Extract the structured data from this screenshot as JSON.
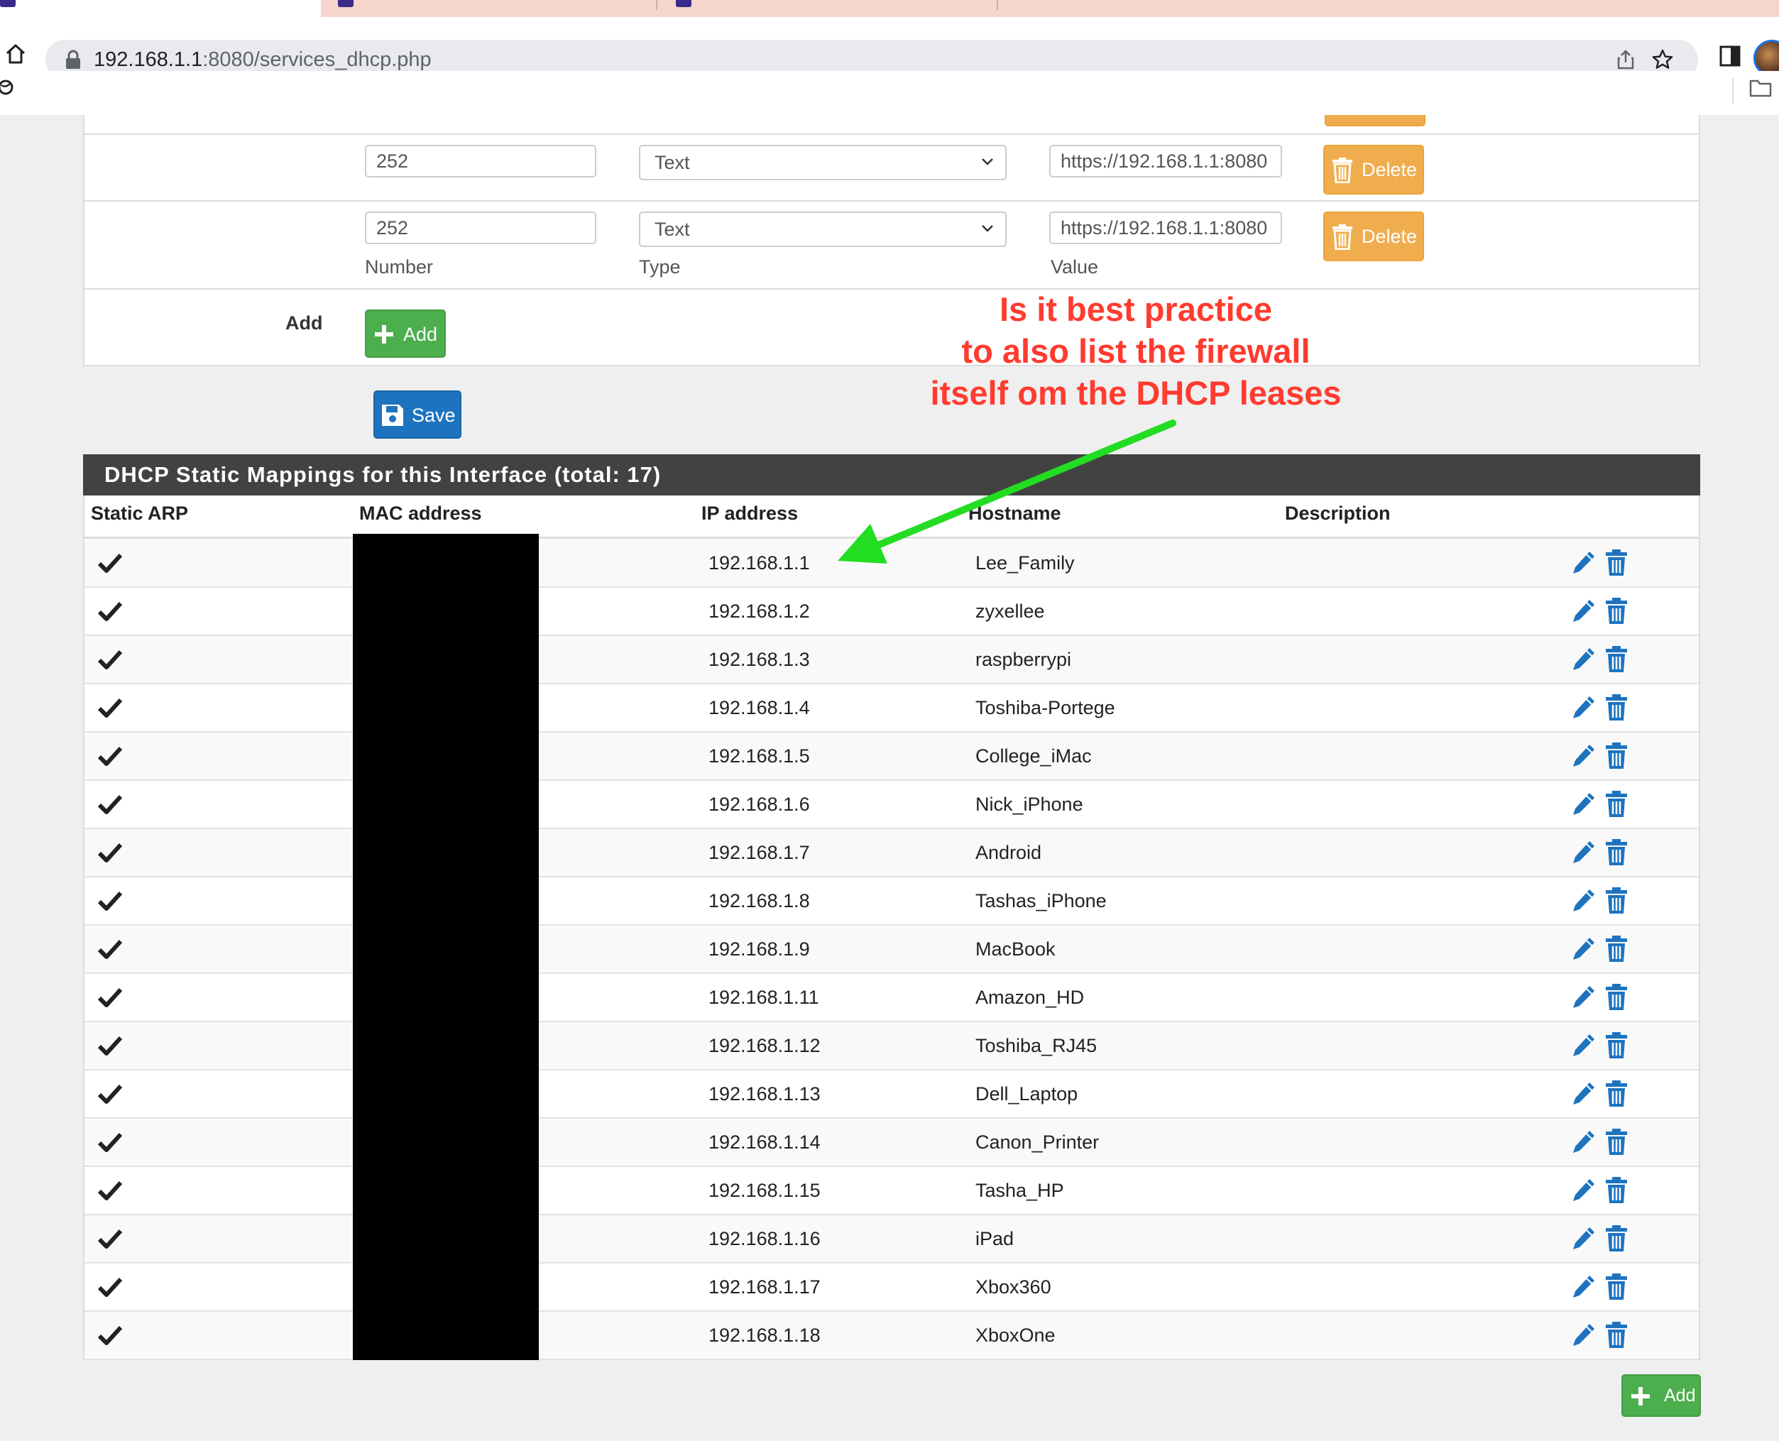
{
  "browser": {
    "url_host": "192.168.1.1",
    "url_rest": ":8080/services_dhcp.php"
  },
  "options": {
    "rows": [
      {
        "number": "252",
        "type": "Text",
        "value": "https://192.168.1.1:8080"
      },
      {
        "number": "252",
        "type": "Text",
        "value": "https://192.168.1.1:8080"
      }
    ],
    "delete_label": "Delete",
    "labels": {
      "number": "Number",
      "type": "Type",
      "value": "Value"
    },
    "add_row_label": "Add",
    "add_button": "Add"
  },
  "save_button": "Save",
  "mappings": {
    "title": "DHCP Static Mappings for this Interface (total: 17)",
    "columns": [
      "Static ARP",
      "MAC address",
      "IP address",
      "Hostname",
      "Description"
    ],
    "rows": [
      {
        "ip": "192.168.1.1",
        "hostname": "Lee_Family"
      },
      {
        "ip": "192.168.1.2",
        "hostname": "zyxellee"
      },
      {
        "ip": "192.168.1.3",
        "hostname": "raspberrypi"
      },
      {
        "ip": "192.168.1.4",
        "hostname": "Toshiba-Portege"
      },
      {
        "ip": "192.168.1.5",
        "hostname": "College_iMac"
      },
      {
        "ip": "192.168.1.6",
        "hostname": "Nick_iPhone"
      },
      {
        "ip": "192.168.1.7",
        "hostname": "Android"
      },
      {
        "ip": "192.168.1.8",
        "hostname": "Tashas_iPhone"
      },
      {
        "ip": "192.168.1.9",
        "hostname": "MacBook"
      },
      {
        "ip": "192.168.1.11",
        "hostname": "Amazon_HD"
      },
      {
        "ip": "192.168.1.12",
        "hostname": "Toshiba_RJ45"
      },
      {
        "ip": "192.168.1.13",
        "hostname": "Dell_Laptop"
      },
      {
        "ip": "192.168.1.14",
        "hostname": "Canon_Printer"
      },
      {
        "ip": "192.168.1.15",
        "hostname": "Tasha_HP"
      },
      {
        "ip": "192.168.1.16",
        "hostname": "iPad"
      },
      {
        "ip": "192.168.1.17",
        "hostname": "Xbox360"
      },
      {
        "ip": "192.168.1.18",
        "hostname": "XboxOne"
      }
    ],
    "add_button": "Add"
  },
  "annotation": {
    "lines": [
      "Is it best practice",
      "to also list the firewall",
      "itself om the DHCP leases"
    ],
    "text_color": "#ff3b2f",
    "arrow_color": "#22dd22"
  },
  "colors": {
    "delete": "#f0ad4e",
    "add": "#4cae4c",
    "save": "#1e73be",
    "panel_heading": "#424242",
    "action_icons": "#1e73be"
  }
}
